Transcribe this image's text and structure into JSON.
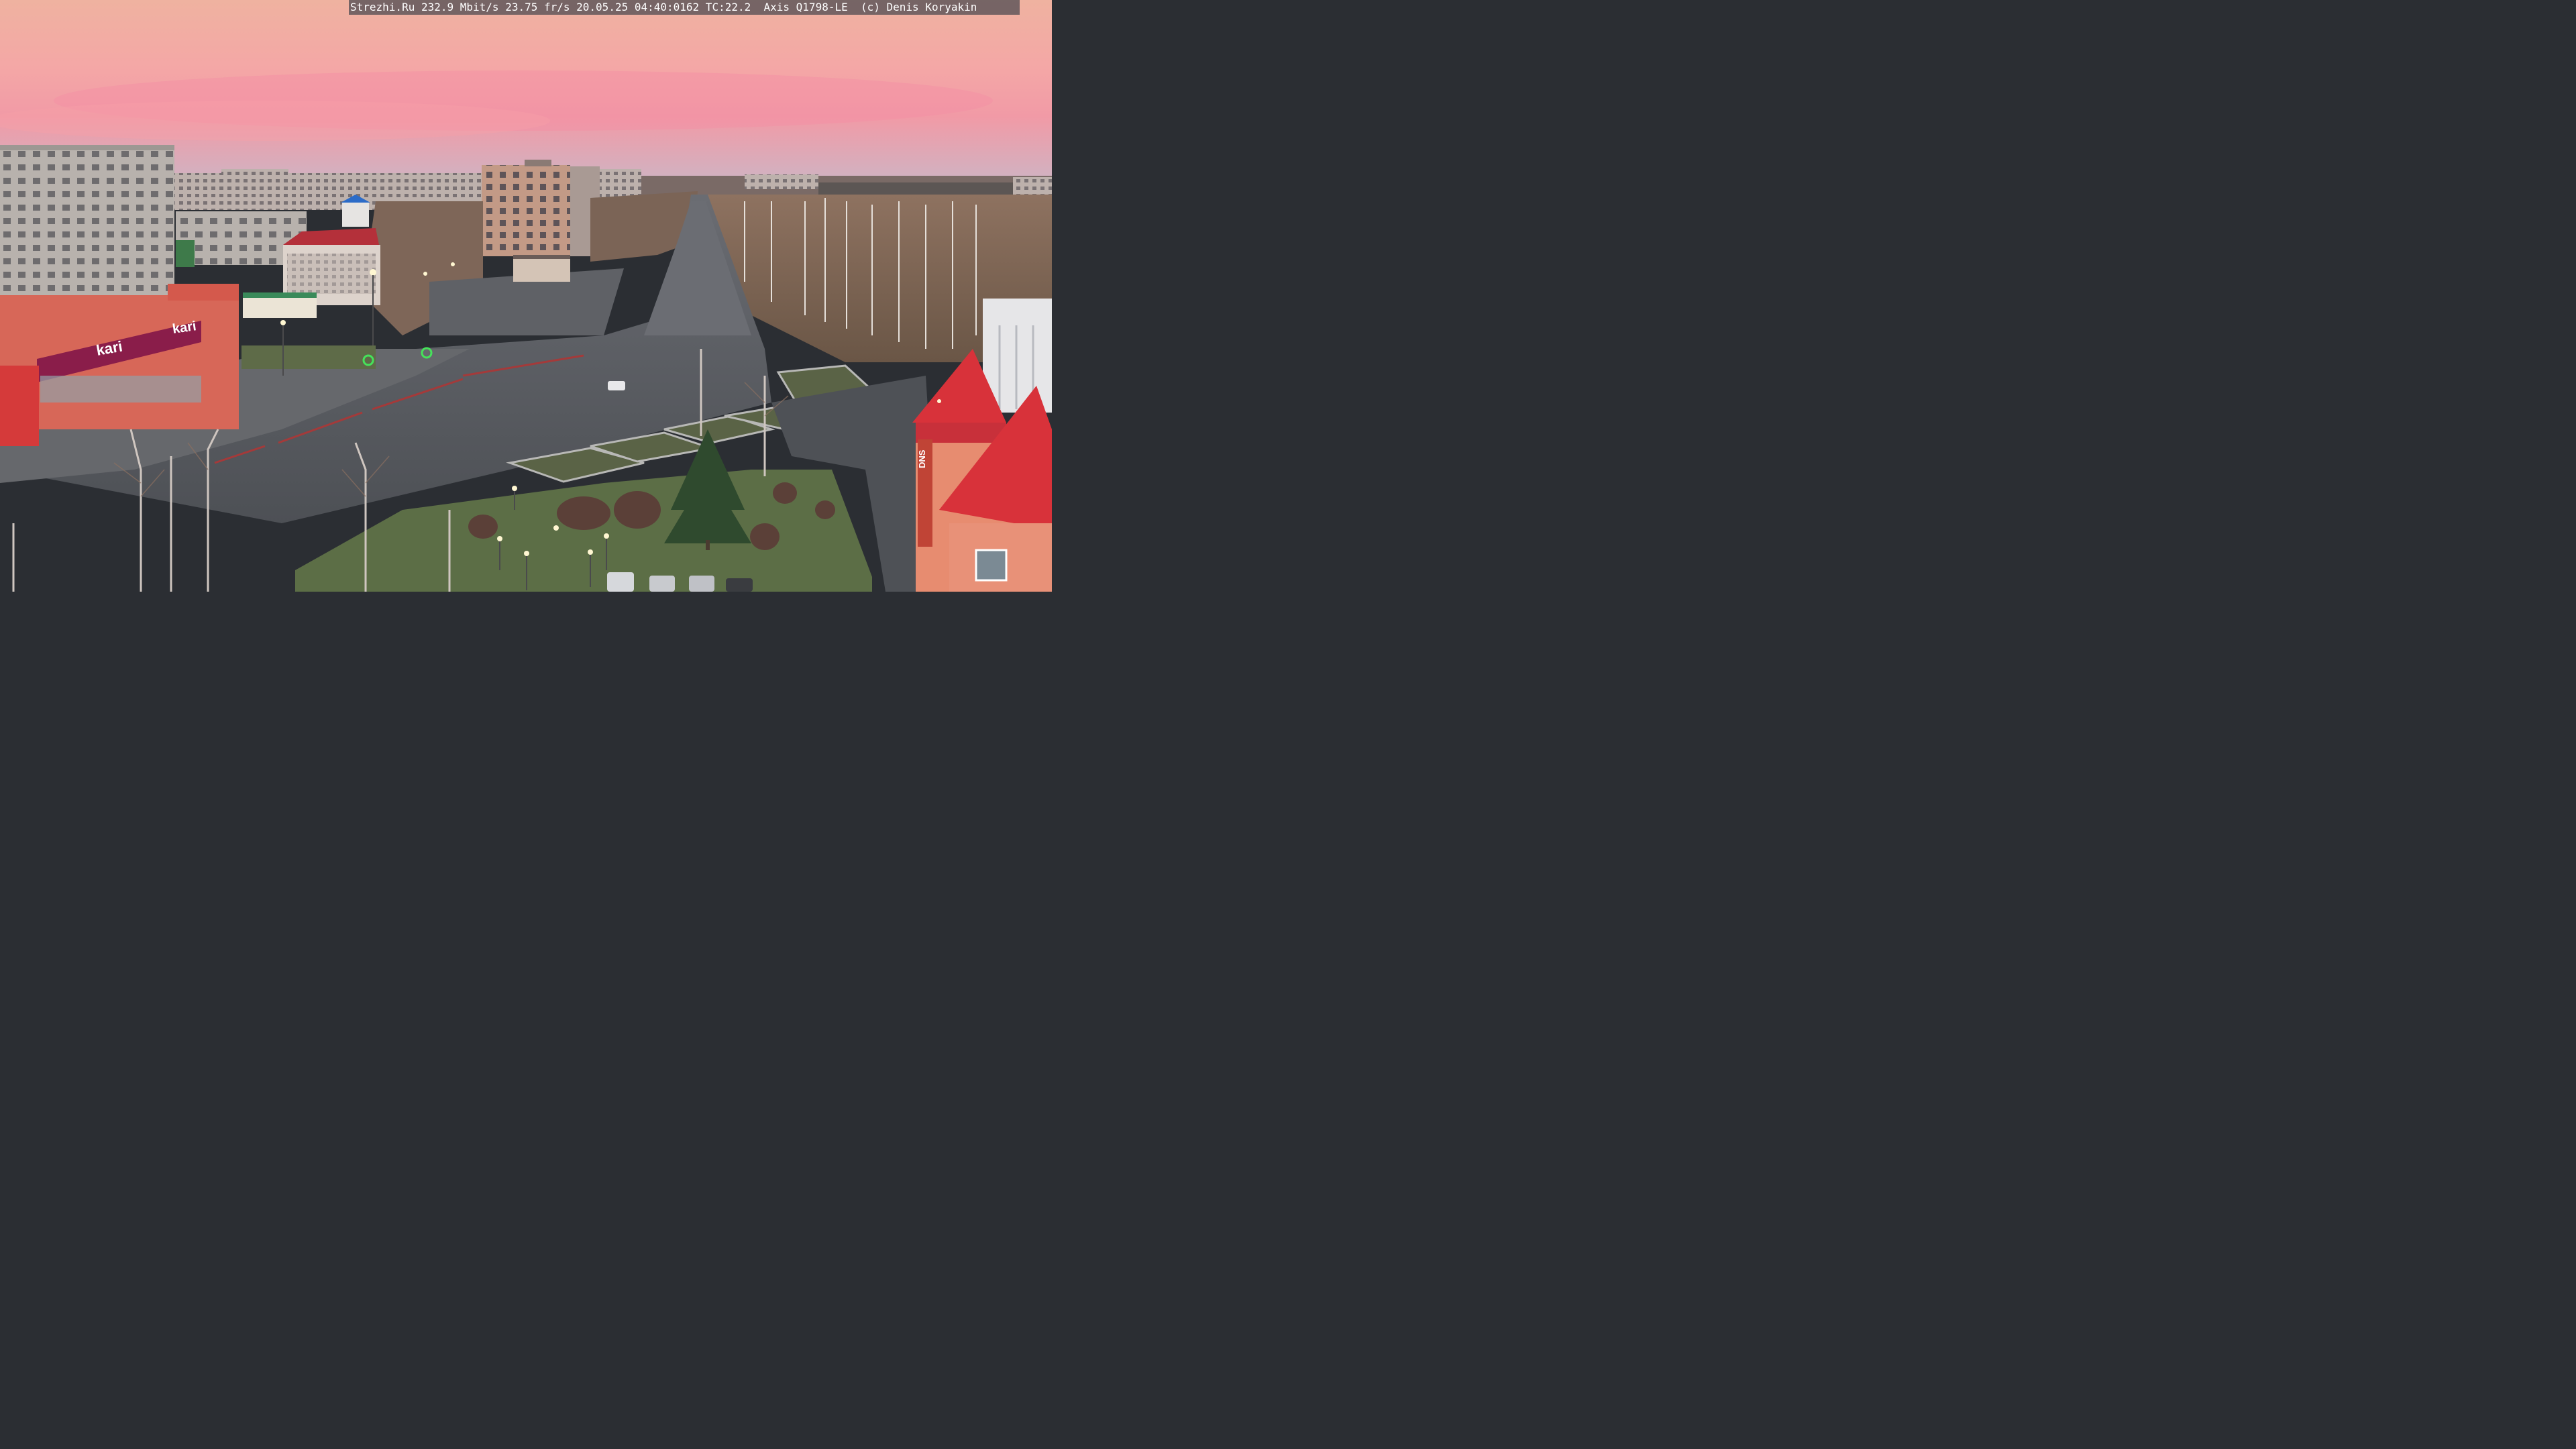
{
  "camera_overlay": {
    "text": "Strezhi.Ru 232.9 Mbit/s 23.75 fr/s 20.05.25 04:40:0162 TC:22.2  Axis Q1798-LE  (c) Denis Koryakin"
  },
  "signage": {
    "store_left": "kari",
    "store_mid": "kari",
    "store_right": "DNS"
  },
  "colors": {
    "sky_top": "#f2b6a4",
    "sky_mid": "#f49aa8",
    "sky_bottom": "#c8b4c4",
    "roof_red": "#d8323a",
    "store_band": "#8a1d4a",
    "pavement": "#5b5e63",
    "grass": "#5c6e46"
  }
}
